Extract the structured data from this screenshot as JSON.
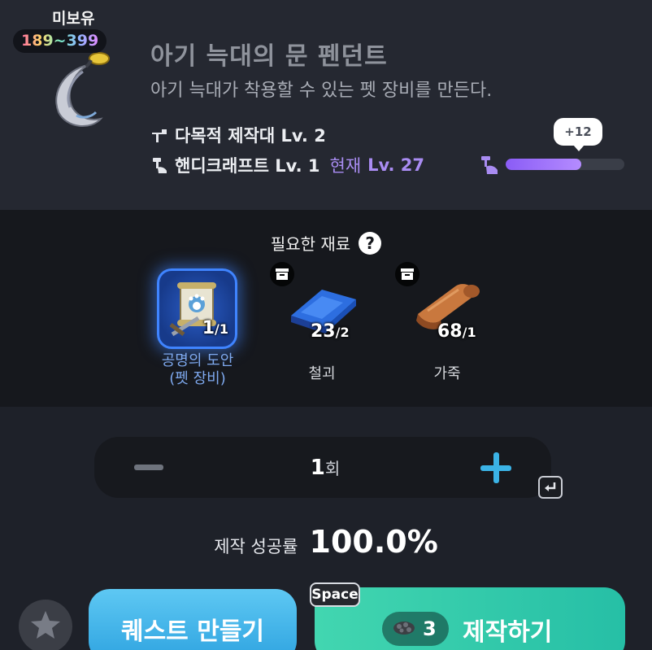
{
  "item": {
    "ownership": "미보유",
    "level_range": "189~399",
    "name": "아기 늑대의 문 펜던트",
    "description": "아기 늑대가 착용할 수 있는 펫 장비를 만든다.",
    "icon": "moon-pendant-icon"
  },
  "requirements": {
    "bench": "다목적 제작대 Lv. 2",
    "skill": "핸디크래프트 Lv. 1",
    "current_label": "현재",
    "current_value": "Lv. 27"
  },
  "experience": {
    "gain_label": "+12",
    "progress_fraction": 0.64
  },
  "materials": {
    "title": "필요한 재료",
    "items": [
      {
        "name_line1": "공명의 도안",
        "name_line2": "(펫 장비)",
        "have": "1",
        "need": "1",
        "icon": "blueprint-scroll-icon",
        "storage_badge": false
      },
      {
        "name_line1": "철괴",
        "have": "23",
        "need": "2",
        "icon": "iron-ingot-icon",
        "storage_badge": true
      },
      {
        "name_line1": "가죽",
        "have": "68",
        "need": "1",
        "icon": "leather-roll-icon",
        "storage_badge": true
      }
    ]
  },
  "quantity": {
    "value": "1",
    "unit": "회"
  },
  "success": {
    "label": "제작 성공률",
    "value": "100.0%"
  },
  "buttons": {
    "quest": "퀘스트 만들기",
    "craft": "제작하기",
    "craft_hotkey": "Space",
    "craft_cost": "3"
  },
  "colors": {
    "accent_purple": "#a98cf2",
    "plus_blue": "#3bb3e6",
    "quest_button": "#2ea3e0",
    "craft_button": "#26bfa6"
  }
}
